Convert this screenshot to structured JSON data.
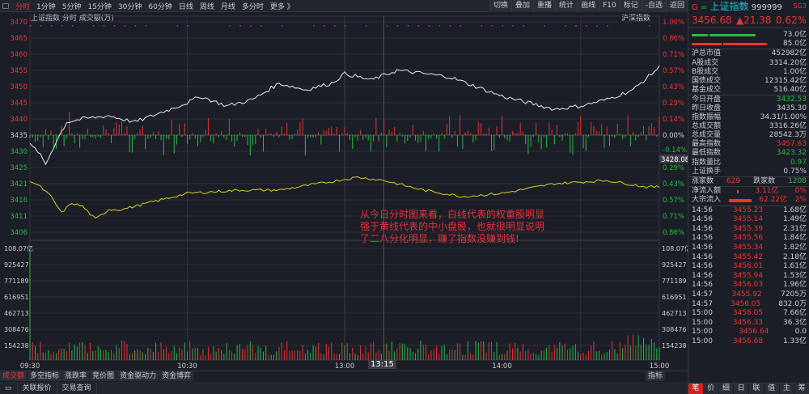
{
  "toolbar": {
    "periods": [
      "分时",
      "1分钟",
      "5分钟",
      "15分钟",
      "30分钟",
      "60分钟",
      "日线",
      "周线",
      "月线",
      "多分时",
      "更多 》"
    ],
    "actions": [
      "切换",
      "叠加",
      "重播",
      "统计",
      "画线",
      "F10",
      "标记",
      "-自选",
      "返回"
    ]
  },
  "chart": {
    "subtitle": "上证指数  分时 成交额(万)",
    "market_label": "沪深指数",
    "price_ticks": [
      "3470",
      "3465",
      "3460",
      "3455",
      "3450",
      "3445",
      "3440",
      "3435",
      "3430",
      "3425",
      "3421",
      "3416",
      "3411",
      "3406"
    ],
    "pct_ticks": [
      "1.00%",
      "0.86%",
      "0.71%",
      "0.57%",
      "0.43%",
      "0.29%",
      "0.14%",
      "0.00%",
      "-0.14%",
      "0.29%",
      "0.43%",
      "0.57%",
      "0.71%",
      "0.86%"
    ],
    "cursor_price": "3428.08",
    "vol_ticks": [
      "108.07亿",
      "925427",
      "771189",
      "616951",
      "462713",
      "308476",
      "154238"
    ],
    "time_ticks": [
      "09:30",
      "10:30",
      "13:00",
      "14:00",
      "15:00"
    ],
    "cursor_time": "13:15",
    "white_line": [
      [
        0,
        3432
      ],
      [
        3,
        3430
      ],
      [
        6,
        3426
      ],
      [
        10,
        3433
      ],
      [
        14,
        3439
      ],
      [
        20,
        3440
      ],
      [
        30,
        3441
      ],
      [
        40,
        3439
      ],
      [
        50,
        3442
      ],
      [
        60,
        3445
      ],
      [
        65,
        3447
      ],
      [
        75,
        3444
      ],
      [
        85,
        3446
      ],
      [
        95,
        3451
      ],
      [
        105,
        3449
      ],
      [
        115,
        3451
      ],
      [
        120,
        3454
      ],
      [
        130,
        3452
      ],
      [
        140,
        3455
      ],
      [
        150,
        3454
      ],
      [
        160,
        3453
      ],
      [
        170,
        3450
      ],
      [
        180,
        3447
      ],
      [
        190,
        3445
      ],
      [
        200,
        3443
      ],
      [
        210,
        3444
      ],
      [
        220,
        3446
      ],
      [
        230,
        3449
      ],
      [
        240,
        3456
      ]
    ],
    "yellow_line": [
      [
        0,
        3421
      ],
      [
        4,
        3419
      ],
      [
        8,
        3416
      ],
      [
        12,
        3411
      ],
      [
        16,
        3414
      ],
      [
        20,
        3413
      ],
      [
        25,
        3409
      ],
      [
        30,
        3412
      ],
      [
        35,
        3412
      ],
      [
        45,
        3414
      ],
      [
        60,
        3417
      ],
      [
        80,
        3418
      ],
      [
        95,
        3418
      ],
      [
        110,
        3420
      ],
      [
        125,
        3422
      ],
      [
        135,
        3421
      ],
      [
        150,
        3418
      ],
      [
        165,
        3416
      ],
      [
        180,
        3417
      ],
      [
        200,
        3420
      ],
      [
        220,
        3421
      ],
      [
        235,
        3419
      ],
      [
        240,
        3419
      ]
    ]
  },
  "annotation": [
    "从今日分时图来看，白线代表的权重股明显",
    "强于黄线代表的中小盘股，也就很明显说明",
    "了二八分化明显，赚了指数没赚到钱!"
  ],
  "bottom_tabs": [
    "成交额",
    "多空指标",
    "涨跌率",
    "竞价图",
    "资金驱动力",
    "资金博弈"
  ],
  "indicator_label": "指标",
  "bottom_bar": [
    "关联报价",
    "交易查询"
  ],
  "panel": {
    "g": "G",
    "eq": "=",
    "name": "上证指数",
    "code": "999999",
    "sg": "SG3",
    "price": "3456.68",
    "change": "▲21.38",
    "pct": "0.62%",
    "bar1": "73.0亿",
    "bar2": "85.0亿",
    "stats": [
      [
        "沪总市值",
        "452982亿",
        ""
      ],
      [
        "A股成交",
        "3314.20亿",
        ""
      ],
      [
        "B股成交",
        "1.00亿",
        ""
      ],
      [
        "国债成交",
        "12315.42亿",
        ""
      ],
      [
        "基金成交",
        "516.40亿",
        ""
      ],
      [
        "今日开盘",
        "3432.53",
        "grn"
      ],
      [
        "昨日收盘",
        "3435.30",
        ""
      ],
      [
        "指数振幅",
        "34.31/1.00%",
        ""
      ],
      [
        "总成交额",
        "3316.26亿",
        ""
      ],
      [
        "总成交量",
        "28542.3万",
        ""
      ],
      [
        "最高指数",
        "3457.63",
        "red"
      ],
      [
        "最低指数",
        "3423.32",
        "grn"
      ],
      [
        "指数量比",
        "0.97",
        "grn"
      ],
      [
        "上证换手",
        "0.75%",
        ""
      ]
    ],
    "up_label": "涨家数",
    "up": "629",
    "down_label": "跌家数",
    "down": "1208",
    "flow": [
      [
        "净流入额",
        "3.11亿",
        "0%"
      ],
      [
        "大宗流入",
        "62.22亿",
        "2%"
      ]
    ],
    "ticks": [
      [
        "14:56",
        "3455.23",
        "1.68亿"
      ],
      [
        "14:56",
        "3455.14",
        "1.49亿"
      ],
      [
        "14:56",
        "3455.39",
        "2.31亿"
      ],
      [
        "14:56",
        "3455.56",
        "1.84亿"
      ],
      [
        "14:56",
        "3455.34",
        "1.82亿"
      ],
      [
        "14:56",
        "3455.42",
        "2.18亿"
      ],
      [
        "14:56",
        "3456.01",
        "1.61亿"
      ],
      [
        "14:56",
        "3455.94",
        "1.53亿"
      ],
      [
        "14:56",
        "3456.03",
        "1.96亿"
      ],
      [
        "14:57",
        "3455.92",
        "7205万"
      ],
      [
        "14:57",
        "3456.05",
        "832.0万"
      ],
      [
        "15:00",
        "3456.05",
        "7.66亿"
      ],
      [
        "15:00",
        "3456.33",
        "36.3亿"
      ],
      [
        "15:00",
        "3456.64",
        "0.0"
      ],
      [
        "15:00",
        "3456.68",
        "1.33亿"
      ]
    ],
    "tabs": [
      "笔",
      "价",
      "细",
      "日",
      "联",
      "值",
      "主",
      "筹"
    ]
  },
  "colors": {
    "up": "#e33333",
    "down": "#2db84a",
    "white_line": "#e8e8e8",
    "yellow_line": "#d8d020"
  }
}
